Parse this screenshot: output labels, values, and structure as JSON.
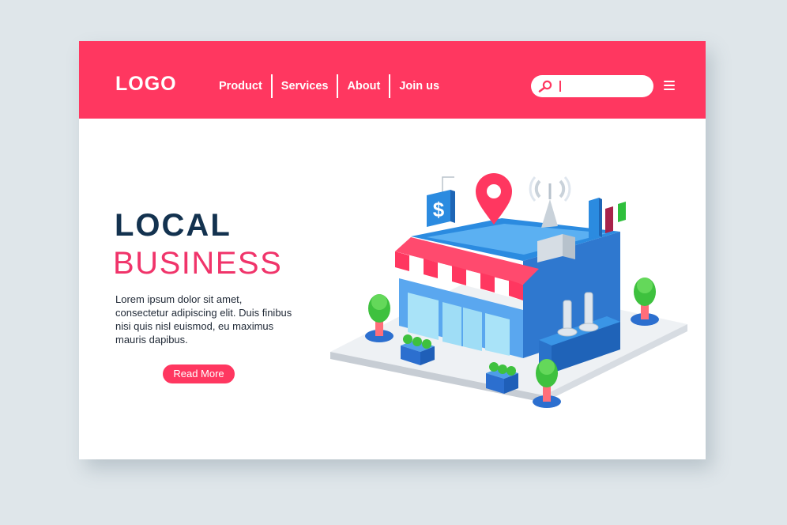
{
  "header": {
    "logo": "LOGO",
    "nav": [
      {
        "label": "Product"
      },
      {
        "label": "Services"
      },
      {
        "label": "About"
      },
      {
        "label": "Join us"
      }
    ],
    "search": {
      "value": "",
      "icon": "search-icon"
    },
    "menu_icon": "hamburger-menu-icon"
  },
  "hero": {
    "title": "LOCAL",
    "subtitle": "BUSINESS",
    "body": "Lorem ipsum dolor sit amet, consectetur adipiscing elit. Duis finibus nisi quis nisl euismod, eu maximus mauris dapibus.",
    "cta_label": "Read More"
  },
  "illustration": {
    "dollar_sign": "$",
    "icons": [
      "store-icon",
      "location-pin-icon",
      "dollar-icon",
      "antenna-icon",
      "bar-chart-icon",
      "tree-icon"
    ]
  },
  "colors": {
    "accent": "#ff3760",
    "navy": "#13324f",
    "page_bg": "#dfe6ea",
    "store_blue": "#2b8be0"
  }
}
